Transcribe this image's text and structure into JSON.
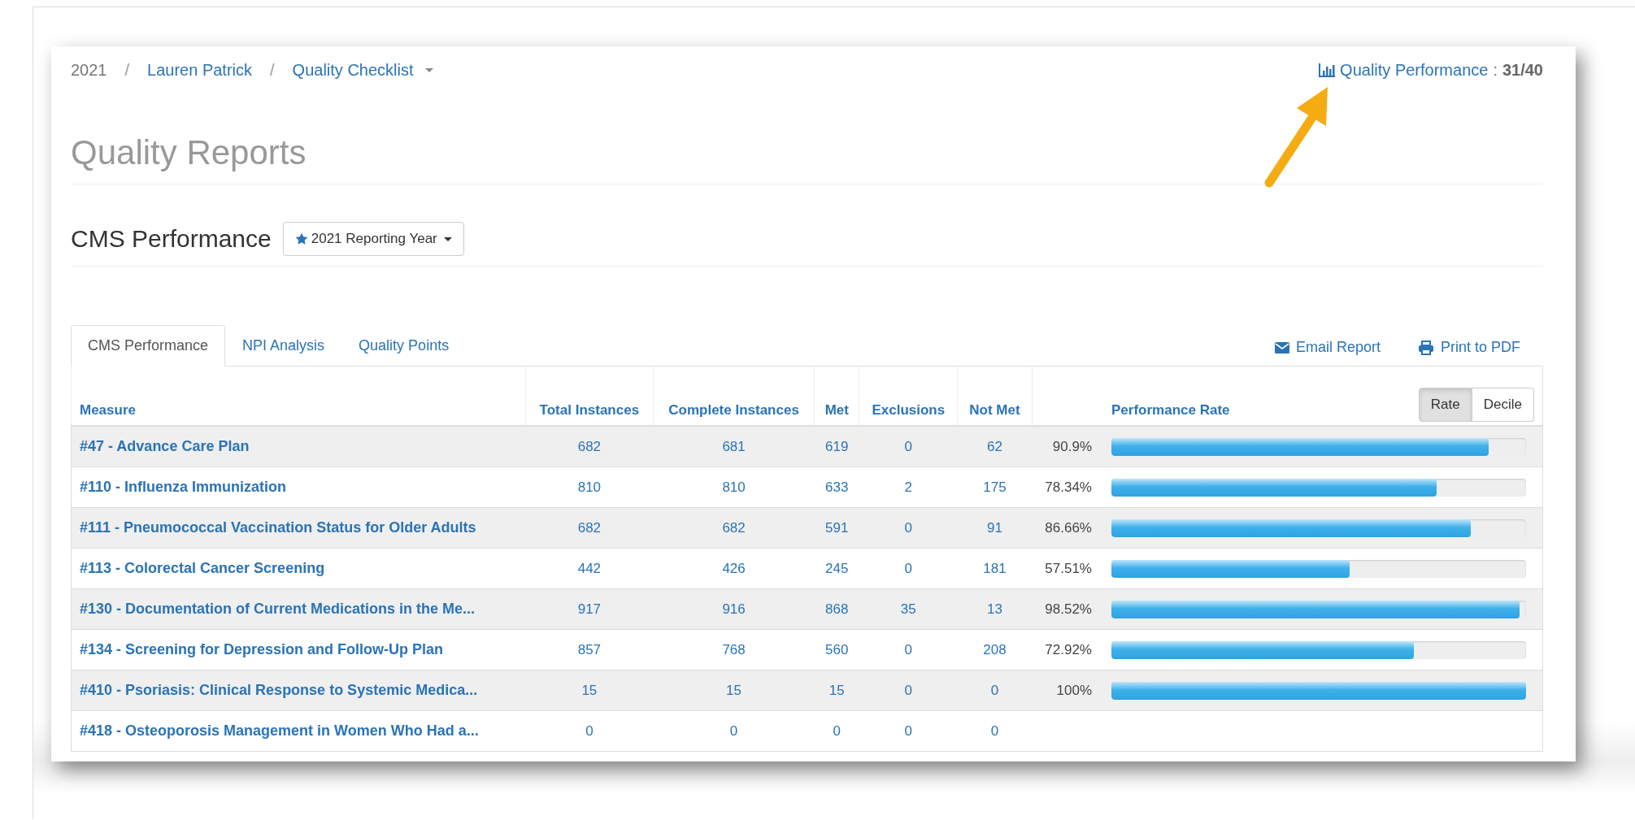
{
  "breadcrumb": {
    "year": "2021",
    "separator": "/",
    "items": [
      {
        "label": "Lauren Patrick",
        "dropdown": false
      },
      {
        "label": "Quality Checklist",
        "dropdown": true
      }
    ]
  },
  "quality_performance": {
    "label": "Quality Performance",
    "separator": ":",
    "score": "31/40"
  },
  "page_title": "Quality Reports",
  "section": {
    "title": "CMS Performance",
    "year_button": "2021 Reporting Year"
  },
  "tabs": [
    {
      "label": "CMS Performance",
      "selected": true
    },
    {
      "label": "NPI Analysis",
      "selected": false
    },
    {
      "label": "Quality Points",
      "selected": false
    }
  ],
  "actions": [
    {
      "kind": "email",
      "label": "Email Report"
    },
    {
      "kind": "print",
      "label": "Print to PDF"
    }
  ],
  "table": {
    "columns": [
      "Measure",
      "Total Instances",
      "Complete Instances",
      "Met",
      "Exclusions",
      "Not Met",
      "Performance Rate"
    ],
    "toggle": [
      {
        "label": "Rate",
        "selected": true
      },
      {
        "label": "Decile",
        "selected": false
      }
    ],
    "rows": [
      {
        "measure": "#47 - Advance Care Plan",
        "total": "682",
        "complete": "681",
        "met": "619",
        "exclusions": "0",
        "not_met": "62",
        "rate": "90.9%",
        "level": 0.909
      },
      {
        "measure": "#110 - Influenza Immunization",
        "total": "810",
        "complete": "810",
        "met": "633",
        "exclusions": "2",
        "not_met": "175",
        "rate": "78.34%",
        "level": 0.7834
      },
      {
        "measure": "#111 - Pneumococcal Vaccination Status for Older Adults",
        "total": "682",
        "complete": "682",
        "met": "591",
        "exclusions": "0",
        "not_met": "91",
        "rate": "86.66%",
        "level": 0.8666
      },
      {
        "measure": "#113 - Colorectal Cancer Screening",
        "total": "442",
        "complete": "426",
        "met": "245",
        "exclusions": "0",
        "not_met": "181",
        "rate": "57.51%",
        "level": 0.5751
      },
      {
        "measure": "#130 - Documentation of Current Medications in the Me...",
        "total": "917",
        "complete": "916",
        "met": "868",
        "exclusions": "35",
        "not_met": "13",
        "rate": "98.52%",
        "level": 0.9852
      },
      {
        "measure": "#134 - Screening for Depression and Follow-Up Plan",
        "total": "857",
        "complete": "768",
        "met": "560",
        "exclusions": "0",
        "not_met": "208",
        "rate": "72.92%",
        "level": 0.7292
      },
      {
        "measure": "#410 - Psoriasis: Clinical Response to Systemic Medica...",
        "total": "15",
        "complete": "15",
        "met": "15",
        "exclusions": "0",
        "not_met": "0",
        "rate": "100%",
        "level": 1
      },
      {
        "measure": "#418 - Osteoporosis Management in Women Who Had a...",
        "total": "0",
        "complete": "0",
        "met": "0",
        "exclusions": "0",
        "not_met": "0"
      }
    ]
  }
}
